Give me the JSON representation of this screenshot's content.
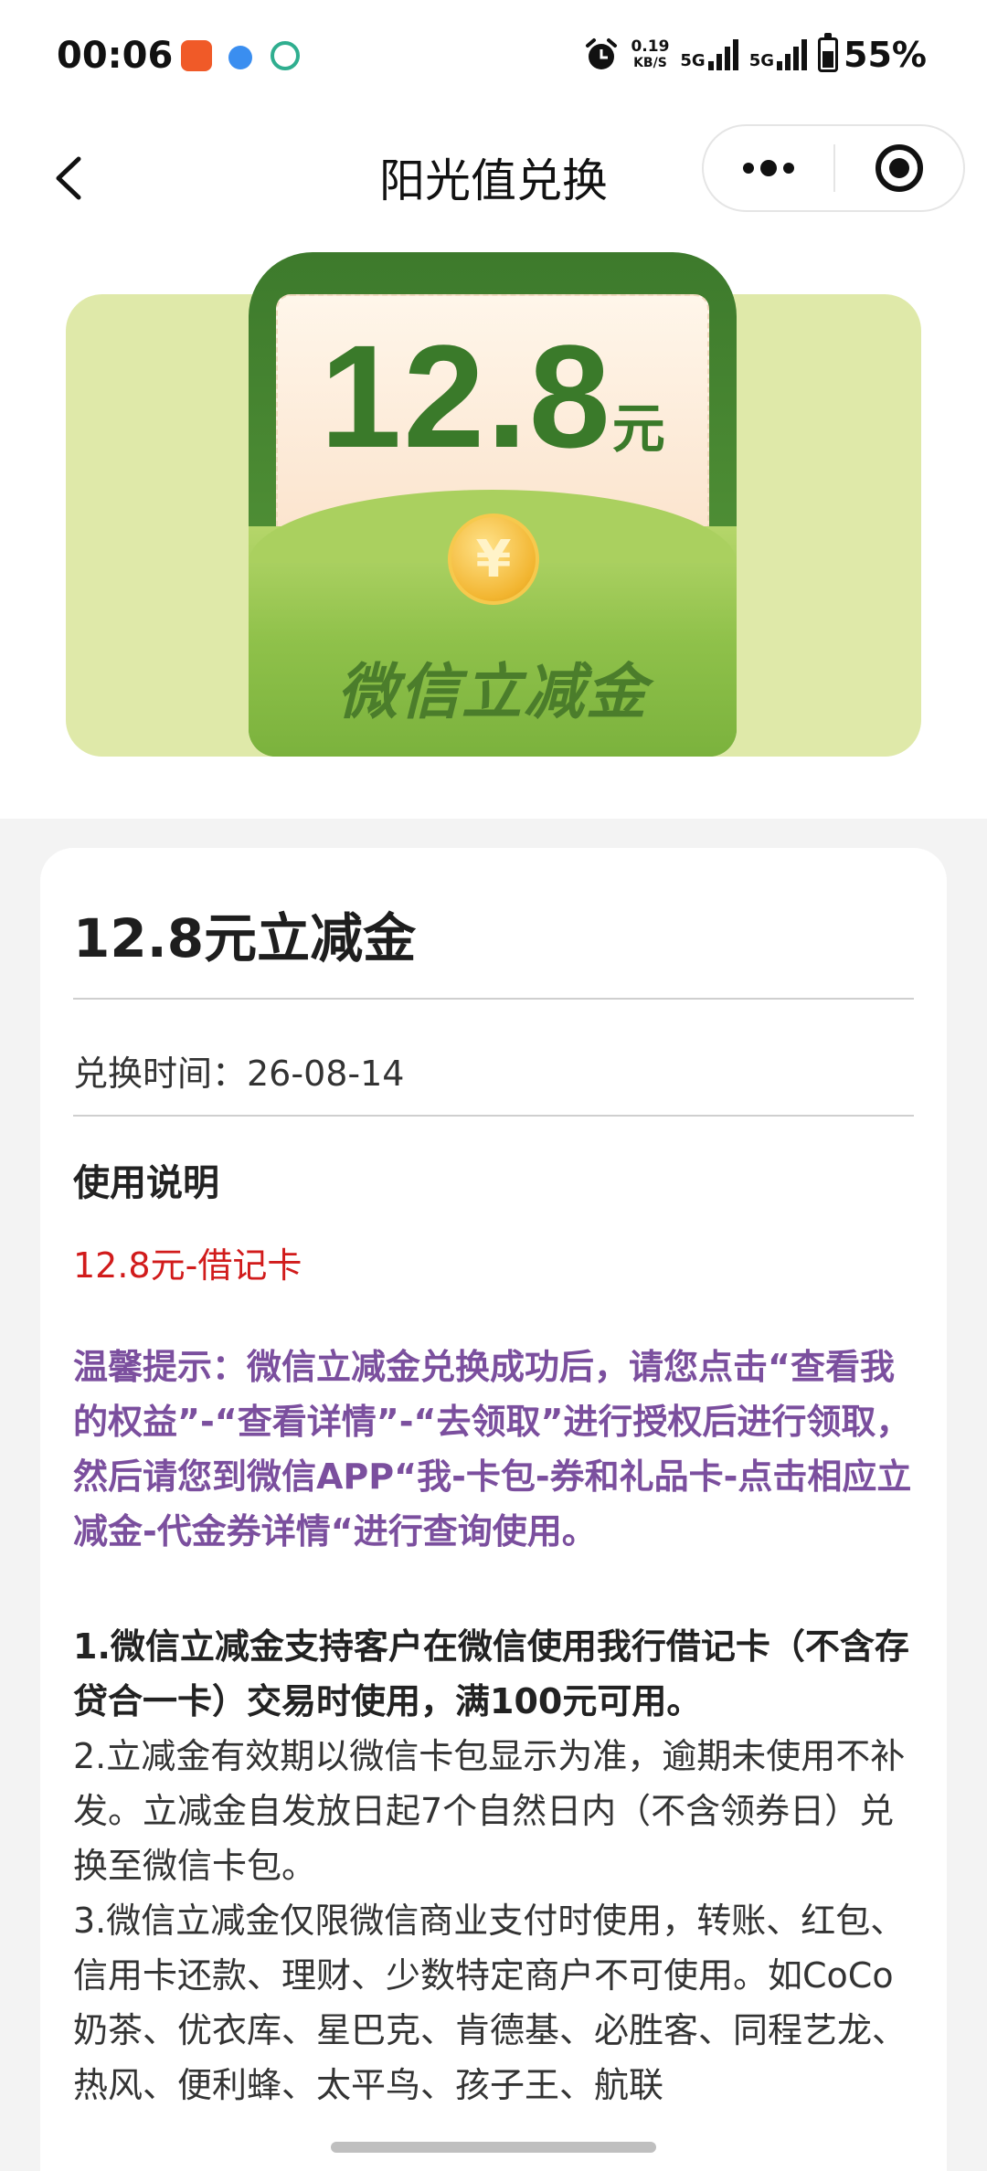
{
  "status_bar": {
    "time": "00:06",
    "net_speed_value": "0.19",
    "net_speed_unit": "KB/S",
    "sim1": "5G",
    "sim2": "5G",
    "battery": "55%"
  },
  "nav": {
    "title": "阳光值兑换"
  },
  "banner": {
    "amount": "12.8",
    "unit": "元",
    "coin_symbol": "¥",
    "caption": "微信立减金"
  },
  "detail": {
    "title": "12.8元立减金",
    "exchange_time": "兑换时间：26-08-14",
    "usage_heading": "使用说明",
    "usage_highlight": "12.8元-借记卡",
    "tip": "温馨提示：微信立减金兑换成功后，请您点击“查看我的权益”-“查看详情”-“去领取”进行授权后进行领取，然后请您到微信APP“我-卡包-券和礼品卡-点击相应立减金-代金券详情“进行查询使用。",
    "rule1": "1.微信立减金支持客户在微信使用我行借记卡（不含存贷合一卡）交易时使用，满100元可用。",
    "rule2": "2.立减金有效期以微信卡包显示为准，逾期未使用不补发。立减金自发放日起7个自然日内（不含领券日）兑换至微信卡包。",
    "rule3": "3.微信立减金仅限微信商业支付时使用，转账、红包、信用卡还款、理财、少数特定商户不可使用。如CoCo奶茶、优衣库、星巴克、肯德基、必胜客、同程艺龙、热风、便利蜂、太平鸟、孩子王、航联"
  },
  "colors": {
    "banner_bg": "#dfe9a9",
    "envelope_green": "#4f8f35",
    "highlight_red": "#d11b1b",
    "tip_purple": "#7b4f9e"
  }
}
